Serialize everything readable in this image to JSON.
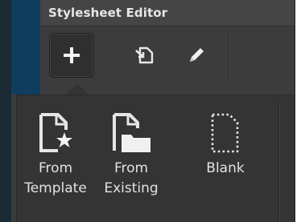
{
  "panel": {
    "title": "Stylesheet Editor"
  },
  "toolbar": {
    "add_icon": "plus-icon",
    "export_icon": "export-icon",
    "edit_icon": "pencil-icon"
  },
  "popup": {
    "options": [
      {
        "line1": "From",
        "line2": "Template",
        "icon": "template-star-icon"
      },
      {
        "line1": "From",
        "line2": "Existing",
        "icon": "folder-document-icon"
      },
      {
        "line1": "Blank",
        "line2": "",
        "icon": "blank-document-icon"
      }
    ]
  },
  "colors": {
    "background": "#3a3a3a",
    "accent_blue": "#0f3d5e",
    "text": "#e2e2e2"
  }
}
